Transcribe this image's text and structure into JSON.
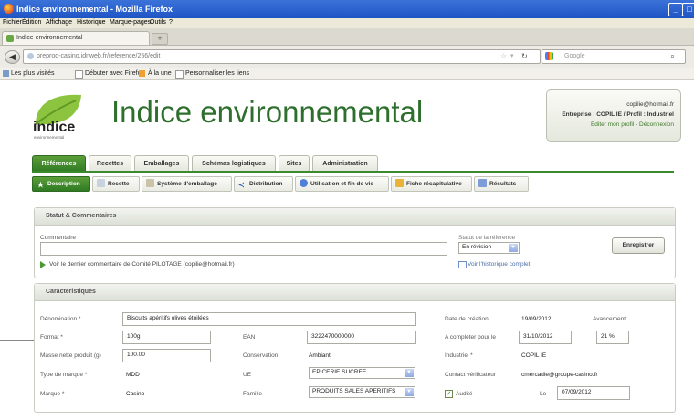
{
  "window": {
    "title": "Indice environnemental - Mozilla Firefox"
  },
  "menu": [
    "Fichier",
    "Édition",
    "Affichage",
    "Historique",
    "Marque-pages",
    "Outils",
    "?"
  ],
  "browser_tab": {
    "title": "Indice environnemental",
    "new_tab": "+"
  },
  "address": {
    "url": "preprod-casino.idnweb.fr/reference/256/edit",
    "search_placeholder": "Google"
  },
  "bookmarks": [
    "Les plus visités",
    "Débuter avec Firefox",
    "À la une",
    "Personnaliser les liens"
  ],
  "app": {
    "logo_text": "indice",
    "logo_sub": "environnemental",
    "title": "Indice environnemental"
  },
  "user": {
    "email": "copilie@hotmail.fr",
    "company": "Entreprise : COPIL IE / Profil : Industriel",
    "links": "Editer mon profil - Déconnexion"
  },
  "main_tabs": [
    "Références",
    "Recettes",
    "Emballages",
    "Schémas logistiques",
    "Sites",
    "Administration"
  ],
  "sub_tabs": [
    "Description",
    "Recette",
    "Système d'emballage",
    "Distribution",
    "Utilisation et fin de vie",
    "Fiche récapitulative",
    "Résultats"
  ],
  "status_panel": {
    "title": "Statut & Commentaires",
    "comment_label": "Commentaire",
    "comment_value": "",
    "status_label": "Statut de la référence",
    "status_value": "En révision",
    "save_button": "Enregistrer",
    "last_comment_link": "Voir le dernier commentaire  de Comité PILOTAGE (copilie@hotmail.fr)",
    "history_link": "Voir l'historique complet"
  },
  "char_panel": {
    "title": "Caractéristiques",
    "denomination_label": "Dénomination *",
    "denomination_value": "Biscuits apéritifs olives étoilées",
    "format_label": "Format *",
    "format_value": "100g",
    "ean_label": "EAN",
    "ean_value": "3222470000000",
    "masse_label": "Masse nette produit (g)",
    "masse_value": "100.00",
    "conservation_label": "Conservation",
    "conservation_value": "Ambiant",
    "type_label": "Type de marque *",
    "type_value": "MDD",
    "ue_label": "UE",
    "ue_value": "EPICERIE SUCREE",
    "marque_label": "Marque *",
    "marque_value": "Casino",
    "famille_label": "Famille",
    "famille_value": "PRODUITS SALES APERITIFS",
    "creation_label": "Date de création",
    "creation_value": "19/09/2012",
    "avancement_label": "Avancement",
    "avancement_value": "21 %",
    "completer_label": "A compléter pour le",
    "completer_value": "31/10/2012",
    "industriel_label": "Industriel *",
    "industriel_value": "COPIL IE",
    "contact_label": "Contact vérificateur",
    "contact_value": "cmercadie@groupe-casino.fr",
    "audite_label": "Audité",
    "le_label": "Le",
    "le_value": "07/09/2012"
  }
}
